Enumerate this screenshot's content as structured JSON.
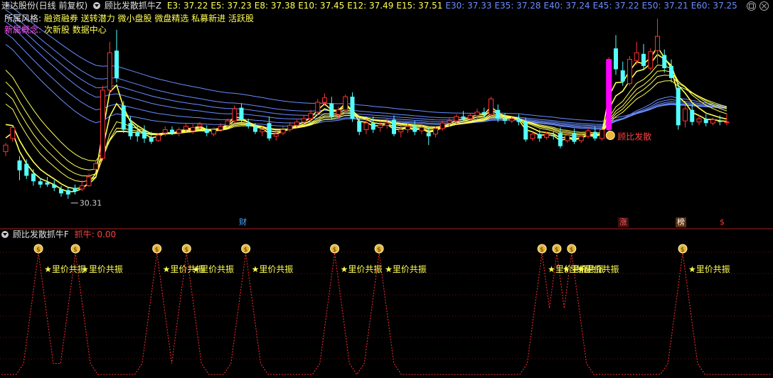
{
  "header": {
    "stock": "速达股份(日线 前复权)",
    "indicator": "顾比发散抓牛Z",
    "ma": [
      {
        "label": "E3: 37.22",
        "color": "#ffff55"
      },
      {
        "label": "E5: 37.23",
        "color": "#ffff55"
      },
      {
        "label": "E8: 37.38",
        "color": "#ffff55"
      },
      {
        "label": "E10: 37.45",
        "color": "#ffff55"
      },
      {
        "label": "E12: 37.49",
        "color": "#ffff55"
      },
      {
        "label": "E15: 37.51",
        "color": "#ffff55"
      },
      {
        "label": "E30: 37.33",
        "color": "#6a8cff"
      },
      {
        "label": "E35: 37.28",
        "color": "#6a8cff"
      },
      {
        "label": "E40: 37.24",
        "color": "#6a8cff"
      },
      {
        "label": "E45: 37.22",
        "color": "#6a8cff"
      },
      {
        "label": "E50: 37.21",
        "color": "#6a8cff"
      },
      {
        "label": "E60: 37.25",
        "color": "#6a8cff"
      }
    ]
  },
  "info": {
    "style_label": "所属风格:",
    "style_value": "融资融券 送转潜力 微小盘股 微盘精选 私募新进 活跃股",
    "concept_label": "新属概念:",
    "concept_value": "次新股 数据中心"
  },
  "annotations": {
    "low_price": "30.31",
    "signal_label": "顾比发散"
  },
  "markers": [
    {
      "label": "财",
      "color": "#4aa8ff"
    },
    {
      "label": "涨",
      "color": "#ff5a5a"
    },
    {
      "label": "榜",
      "color": "#ffffff"
    },
    {
      "label": "$",
      "color": "#ff3030"
    }
  ],
  "lower": {
    "indicator": "顾比发散抓牛F",
    "value_label": "抓牛: 0.00",
    "signal_text": "★里价共振"
  },
  "colors": {
    "up": "#ff3232",
    "down": "#54ffff",
    "fast_ma": "#ffff55",
    "slow_ma": "#6a8cff",
    "divider": "#b02020",
    "signal_bar": "#ff00ff"
  },
  "chart_data": {
    "type": "candlestick",
    "ylim": [
      29.0,
      47.5
    ],
    "candles": [
      {
        "o": 34.6,
        "h": 35.4,
        "c": 35.2,
        "l": 34.2
      },
      {
        "o": 35.8,
        "h": 36.3,
        "c": 36.8,
        "l": 35.5
      },
      {
        "o": 33.8,
        "h": 34.2,
        "c": 32.9,
        "l": 32.0
      },
      {
        "o": 33.5,
        "h": 33.9,
        "c": 32.4,
        "l": 32.1
      },
      {
        "o": 32.6,
        "h": 33.0,
        "c": 31.9,
        "l": 31.5
      },
      {
        "o": 31.9,
        "h": 32.2,
        "c": 31.6,
        "l": 31.3
      },
      {
        "o": 31.8,
        "h": 32.3,
        "c": 31.6,
        "l": 31.4
      },
      {
        "o": 31.6,
        "h": 32.0,
        "c": 31.3,
        "l": 31.0
      },
      {
        "o": 31.2,
        "h": 31.5,
        "c": 30.8,
        "l": 30.5
      },
      {
        "o": 31.1,
        "h": 31.4,
        "c": 30.7,
        "l": 30.31
      },
      {
        "o": 31.3,
        "h": 31.6,
        "c": 31.0,
        "l": 30.7
      },
      {
        "o": 31.2,
        "h": 32.0,
        "c": 31.5,
        "l": 31.0
      },
      {
        "o": 31.5,
        "h": 32.6,
        "c": 32.3,
        "l": 31.4
      },
      {
        "o": 33.0,
        "h": 33.8,
        "c": 33.5,
        "l": 32.8
      },
      {
        "o": 34.0,
        "h": 40.6,
        "c": 40.2,
        "l": 33.8
      },
      {
        "o": 40.2,
        "h": 44.6,
        "c": 43.6,
        "l": 39.8
      },
      {
        "o": 43.8,
        "h": 45.7,
        "c": 41.3,
        "l": 40.9
      },
      {
        "o": 38.8,
        "h": 39.2,
        "c": 36.6,
        "l": 36.3
      },
      {
        "o": 37.2,
        "h": 37.8,
        "c": 36.0,
        "l": 35.7
      },
      {
        "o": 36.4,
        "h": 37.0,
        "c": 36.0,
        "l": 35.5
      },
      {
        "o": 36.5,
        "h": 37.0,
        "c": 35.8,
        "l": 35.4
      },
      {
        "o": 35.9,
        "h": 36.4,
        "c": 35.5,
        "l": 35.3
      },
      {
        "o": 35.6,
        "h": 36.3,
        "c": 36.1,
        "l": 35.5
      },
      {
        "o": 36.3,
        "h": 36.9,
        "c": 36.6,
        "l": 36.0
      },
      {
        "o": 36.6,
        "h": 36.9,
        "c": 36.3,
        "l": 36.1
      },
      {
        "o": 36.3,
        "h": 36.8,
        "c": 36.6,
        "l": 36.0
      },
      {
        "o": 36.6,
        "h": 37.2,
        "c": 36.9,
        "l": 36.4
      },
      {
        "o": 36.5,
        "h": 37.1,
        "c": 36.8,
        "l": 36.2
      },
      {
        "o": 36.9,
        "h": 37.3,
        "c": 37.1,
        "l": 36.6
      },
      {
        "o": 36.6,
        "h": 37.0,
        "c": 36.3,
        "l": 36.0
      },
      {
        "o": 36.2,
        "h": 36.8,
        "c": 36.6,
        "l": 36.0
      },
      {
        "o": 36.6,
        "h": 37.2,
        "c": 36.9,
        "l": 36.4
      },
      {
        "o": 37.0,
        "h": 37.6,
        "c": 37.4,
        "l": 36.8
      },
      {
        "o": 37.4,
        "h": 38.8,
        "c": 38.5,
        "l": 37.2
      },
      {
        "o": 38.6,
        "h": 39.0,
        "c": 37.5,
        "l": 37.2
      },
      {
        "o": 37.2,
        "h": 37.6,
        "c": 36.9,
        "l": 36.7
      },
      {
        "o": 36.9,
        "h": 37.2,
        "c": 36.4,
        "l": 36.2
      },
      {
        "o": 36.4,
        "h": 36.9,
        "c": 36.6,
        "l": 36.0
      },
      {
        "o": 37.2,
        "h": 37.8,
        "c": 35.8,
        "l": 35.6
      },
      {
        "o": 36.0,
        "h": 36.5,
        "c": 36.2,
        "l": 35.6
      },
      {
        "o": 36.3,
        "h": 36.9,
        "c": 36.6,
        "l": 36.1
      },
      {
        "o": 36.6,
        "h": 37.3,
        "c": 37.0,
        "l": 36.4
      },
      {
        "o": 37.0,
        "h": 37.5,
        "c": 37.3,
        "l": 36.8
      },
      {
        "o": 37.3,
        "h": 37.9,
        "c": 37.6,
        "l": 37.1
      },
      {
        "o": 37.6,
        "h": 38.4,
        "c": 38.1,
        "l": 37.4
      },
      {
        "o": 38.2,
        "h": 39.4,
        "c": 39.1,
        "l": 37.9
      },
      {
        "o": 39.1,
        "h": 39.9,
        "c": 39.5,
        "l": 38.8
      },
      {
        "o": 39.0,
        "h": 39.6,
        "c": 37.8,
        "l": 37.5
      },
      {
        "o": 38.0,
        "h": 38.7,
        "c": 38.4,
        "l": 37.6
      },
      {
        "o": 38.4,
        "h": 39.8,
        "c": 39.6,
        "l": 38.2
      },
      {
        "o": 39.6,
        "h": 40.0,
        "c": 37.6,
        "l": 37.3
      },
      {
        "o": 37.4,
        "h": 37.8,
        "c": 36.4,
        "l": 36.1
      },
      {
        "o": 36.6,
        "h": 37.6,
        "c": 37.2,
        "l": 36.2
      },
      {
        "o": 37.2,
        "h": 37.8,
        "c": 36.6,
        "l": 36.3
      },
      {
        "o": 36.8,
        "h": 37.4,
        "c": 37.0,
        "l": 36.4
      },
      {
        "o": 37.0,
        "h": 37.6,
        "c": 37.2,
        "l": 36.7
      },
      {
        "o": 37.5,
        "h": 37.9,
        "c": 36.2,
        "l": 36.0
      },
      {
        "o": 36.4,
        "h": 36.9,
        "c": 36.6,
        "l": 35.9
      },
      {
        "o": 36.6,
        "h": 37.2,
        "c": 36.9,
        "l": 36.3
      },
      {
        "o": 36.9,
        "h": 37.4,
        "c": 36.4,
        "l": 36.1
      },
      {
        "o": 36.5,
        "h": 37.0,
        "c": 36.8,
        "l": 36.2
      },
      {
        "o": 36.3,
        "h": 36.8,
        "c": 36.0,
        "l": 35.2
      },
      {
        "o": 36.2,
        "h": 36.9,
        "c": 36.7,
        "l": 35.9
      },
      {
        "o": 36.7,
        "h": 37.4,
        "c": 37.2,
        "l": 36.5
      },
      {
        "o": 37.2,
        "h": 37.7,
        "c": 37.4,
        "l": 36.9
      },
      {
        "o": 37.4,
        "h": 38.0,
        "c": 37.8,
        "l": 37.1
      },
      {
        "o": 37.8,
        "h": 38.3,
        "c": 37.6,
        "l": 37.3
      },
      {
        "o": 37.6,
        "h": 38.1,
        "c": 37.9,
        "l": 37.4
      },
      {
        "o": 37.9,
        "h": 38.5,
        "c": 38.2,
        "l": 37.6
      },
      {
        "o": 38.2,
        "h": 38.6,
        "c": 38.0,
        "l": 37.7
      },
      {
        "o": 38.0,
        "h": 39.6,
        "c": 39.4,
        "l": 37.8
      },
      {
        "o": 38.4,
        "h": 38.9,
        "c": 37.6,
        "l": 37.3
      },
      {
        "o": 37.6,
        "h": 38.1,
        "c": 37.4,
        "l": 37.1
      },
      {
        "o": 37.4,
        "h": 37.8,
        "c": 37.6,
        "l": 37.2
      },
      {
        "o": 37.6,
        "h": 38.0,
        "c": 37.3,
        "l": 37.0
      },
      {
        "o": 37.3,
        "h": 37.7,
        "c": 35.7,
        "l": 35.5
      },
      {
        "o": 35.8,
        "h": 36.4,
        "c": 36.2,
        "l": 35.6
      },
      {
        "o": 36.2,
        "h": 36.6,
        "c": 35.8,
        "l": 35.5
      },
      {
        "o": 35.9,
        "h": 36.4,
        "c": 36.2,
        "l": 35.7
      },
      {
        "o": 36.1,
        "h": 36.5,
        "c": 36.0,
        "l": 35.7
      },
      {
        "o": 36.3,
        "h": 36.8,
        "c": 35.1,
        "l": 34.9
      },
      {
        "o": 35.6,
        "h": 36.3,
        "c": 36.1,
        "l": 35.4
      },
      {
        "o": 36.3,
        "h": 36.7,
        "c": 35.5,
        "l": 35.3
      },
      {
        "o": 35.6,
        "h": 36.3,
        "c": 36.0,
        "l": 35.4
      },
      {
        "o": 36.0,
        "h": 36.8,
        "c": 36.5,
        "l": 35.8
      },
      {
        "o": 36.4,
        "h": 36.9,
        "c": 35.8,
        "l": 35.6
      },
      {
        "o": 35.8,
        "h": 36.8,
        "c": 36.6,
        "l": 35.6
      },
      {
        "o": 36.6,
        "h": 43.2,
        "c": 43.0,
        "l": 36.4
      },
      {
        "o": 44.0,
        "h": 45.2,
        "c": 42.1,
        "l": 41.6
      },
      {
        "o": 42.0,
        "h": 42.8,
        "c": 41.0,
        "l": 40.6
      },
      {
        "o": 40.8,
        "h": 43.3,
        "c": 43.0,
        "l": 40.6
      },
      {
        "o": 42.9,
        "h": 44.6,
        "c": 43.6,
        "l": 42.5
      },
      {
        "o": 43.5,
        "h": 44.4,
        "c": 42.4,
        "l": 42.0
      },
      {
        "o": 42.2,
        "h": 44.0,
        "c": 43.7,
        "l": 42.0
      },
      {
        "o": 43.8,
        "h": 46.7,
        "c": 45.1,
        "l": 42.6
      },
      {
        "o": 43.4,
        "h": 43.9,
        "c": 42.2,
        "l": 41.8
      },
      {
        "o": 42.4,
        "h": 43.0,
        "c": 41.3,
        "l": 40.9
      },
      {
        "o": 40.4,
        "h": 40.8,
        "c": 37.0,
        "l": 36.6
      },
      {
        "o": 37.4,
        "h": 38.8,
        "c": 38.5,
        "l": 36.8
      },
      {
        "o": 38.4,
        "h": 38.9,
        "c": 37.3,
        "l": 37.0
      },
      {
        "o": 37.3,
        "h": 37.9,
        "c": 37.6,
        "l": 37.0
      },
      {
        "o": 37.6,
        "h": 38.0,
        "c": 37.2,
        "l": 36.9
      },
      {
        "o": 37.2,
        "h": 37.7,
        "c": 37.5,
        "l": 37.0
      },
      {
        "o": 37.4,
        "h": 37.9,
        "c": 37.3,
        "l": 37.0
      },
      {
        "o": 37.3,
        "h": 38.1,
        "c": 37.3,
        "l": 37.0
      }
    ],
    "signal_bar_index": 87,
    "signal_indices": [
      5,
      10,
      21,
      25,
      33,
      45,
      51,
      73,
      75,
      77,
      92
    ],
    "signal_ylim": [
      0,
      1
    ]
  }
}
